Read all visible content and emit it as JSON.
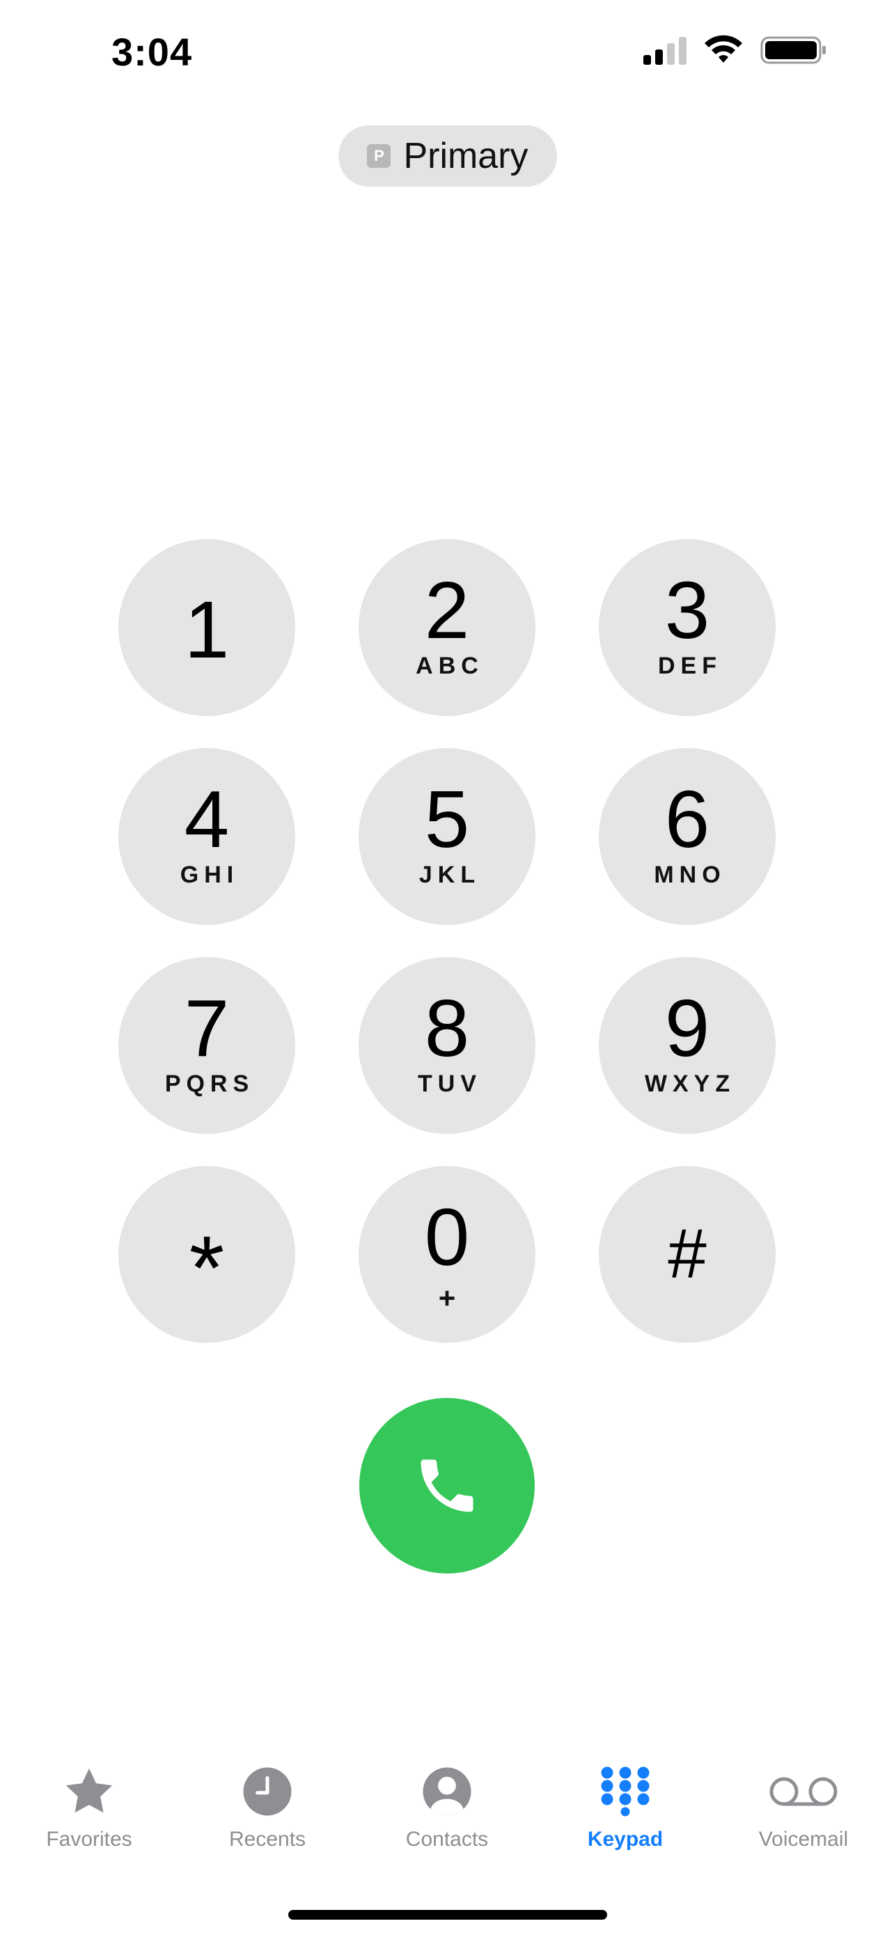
{
  "status_bar": {
    "time": "3:04",
    "signal_bars_active": 2,
    "signal_bars_total": 4,
    "wifi_icon": "wifi-icon",
    "battery_icon": "battery-full-icon"
  },
  "sim": {
    "badge": "P",
    "label": "Primary"
  },
  "keypad": {
    "keys": [
      {
        "digit": "1",
        "letters": ""
      },
      {
        "digit": "2",
        "letters": "ABC"
      },
      {
        "digit": "3",
        "letters": "DEF"
      },
      {
        "digit": "4",
        "letters": "GHI"
      },
      {
        "digit": "5",
        "letters": "JKL"
      },
      {
        "digit": "6",
        "letters": "MNO"
      },
      {
        "digit": "7",
        "letters": "PQRS"
      },
      {
        "digit": "8",
        "letters": "TUV"
      },
      {
        "digit": "9",
        "letters": "WXYZ"
      },
      {
        "digit": "*",
        "letters": ""
      },
      {
        "digit": "0",
        "letters": "+"
      },
      {
        "digit": "#",
        "letters": ""
      }
    ]
  },
  "call": {
    "icon": "phone-icon",
    "color": "#35c759"
  },
  "tabs": [
    {
      "label": "Favorites",
      "icon": "star-icon",
      "active": false
    },
    {
      "label": "Recents",
      "icon": "clock-icon",
      "active": false
    },
    {
      "label": "Contacts",
      "icon": "person-circle-icon",
      "active": false
    },
    {
      "label": "Keypad",
      "icon": "keypad-grid-icon",
      "active": true
    },
    {
      "label": "Voicemail",
      "icon": "voicemail-icon",
      "active": false
    }
  ],
  "colors": {
    "accent": "#147efb",
    "inactive": "#8e8e93",
    "key_background": "#e5e5e5"
  }
}
